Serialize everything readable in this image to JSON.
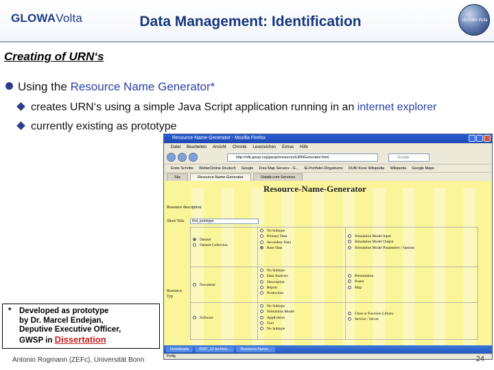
{
  "header": {
    "logo_part1": "GLOWA",
    "logo_part2": "Volta",
    "title": "Data Management: Identification",
    "globe_text": "GLOWA Volta"
  },
  "slide": {
    "subtitle": "Creating of URN‘s",
    "bullet_prefix": "Using the",
    "bullet_highlight": "Resource Name Generator*",
    "sub1_prefix": "creates URN‘s using a simple Java Script application running in an",
    "sub1_highlight": "internet explorer",
    "sub2": "currently existing as prototype",
    "footnote_star": "*",
    "footnote_l1": "Developed as prototype",
    "footnote_l2": "by Dr. Marcel Endejan,",
    "footnote_l3": "Deputive Executive Officer,",
    "footnote_l4": "GWSP in",
    "footnote_link": "Dissertation",
    "footer": "Antonio Rogmann (ZEFc), Universität Bonn",
    "page_number": "24"
  },
  "browser": {
    "window_title": "Resource-Name-Generator - Mozilla Firefox",
    "menu": [
      "Datei",
      "Bearbeiten",
      "Ansicht",
      "Chronik",
      "Lesezeichen",
      "Extras",
      "Hilfe"
    ],
    "url": "http://rdb.gwsp.org/gwsp/resources/URNGenerator.html",
    "search_placeholder": "Google",
    "bookmarks": [
      "Erste Schritte",
      "WetterOnline Deutsch",
      "Google",
      "Free Map Servers - G...",
      "IE-Portfolio-Dingsbums",
      "DUBI Kose Wikipedia",
      "Wikipedia",
      "Google Maps"
    ],
    "tabs": [
      "Sky",
      "Resource-Name-Generator",
      "Ostalb.com Services"
    ],
    "page_title": "Resource-Name-Generator",
    "resource_description": "Resource description",
    "short_title_label": "Short Title",
    "short_title_value": "first_prototype",
    "resource_typ_label_1": "Resource",
    "resource_typ_label_2": "Typ",
    "rows": [
      {
        "type": "Dataset",
        "type2": "Dataset Collection",
        "col2": [
          "No Subtype",
          "Primary Data",
          "Secondary Data",
          "Base Data"
        ],
        "col3": [
          "Simulation Model Input",
          "Simulation Model Output",
          "Simulation Model Parameters / Options"
        ]
      },
      {
        "type": "Document",
        "col2": [
          "No Subtype",
          "Data Analysis",
          "Description",
          "Report",
          "Production"
        ],
        "col3": [
          "Presentation",
          "Poster",
          "Map"
        ]
      },
      {
        "type": "Software",
        "col2": [
          "No Subtype",
          "Simulation Model",
          "Application",
          "Tool",
          "No Subtype"
        ],
        "col3": [
          "Class or Function Library",
          "Service / Server"
        ]
      }
    ],
    "taskbar": [
      "Downloads",
      "2007_12 archivo...",
      "Resource-Name..."
    ],
    "status": "Fertig"
  }
}
